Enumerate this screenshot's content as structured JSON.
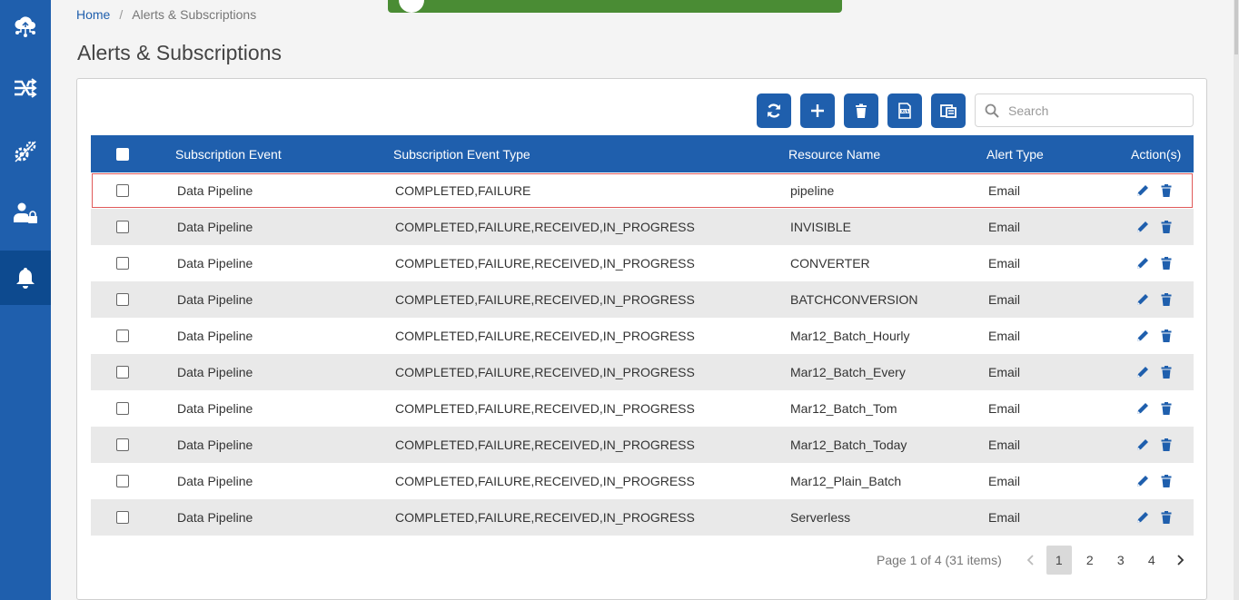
{
  "breadcrumb": {
    "home": "Home",
    "separator": "/",
    "current": "Alerts & Subscriptions"
  },
  "page": {
    "title": "Alerts & Subscriptions"
  },
  "sidebar": {
    "items": [
      {
        "icon": "cloud-network-icon",
        "active": false
      },
      {
        "icon": "pipeline-shuffle-icon",
        "active": false
      },
      {
        "icon": "settings-gears-icon",
        "active": false
      },
      {
        "icon": "user-lock-icon",
        "active": false
      },
      {
        "icon": "bell-icon",
        "active": true
      }
    ]
  },
  "toast": {
    "color": "#4a8c34"
  },
  "toolbar": {
    "buttons": [
      "refresh-icon",
      "plus-icon",
      "trash-icon",
      "xlsx-export-icon",
      "column-settings-icon"
    ],
    "search_placeholder": "Search"
  },
  "table": {
    "headers": {
      "event": "Subscription Event",
      "event_type": "Subscription Event Type",
      "resource": "Resource Name",
      "alert_type": "Alert Type",
      "actions": "Action(s)"
    },
    "rows": [
      {
        "event": "Data Pipeline",
        "event_type": "COMPLETED,FAILURE",
        "resource": "pipeline",
        "alert_type": "Email"
      },
      {
        "event": "Data Pipeline",
        "event_type": "COMPLETED,FAILURE,RECEIVED,IN_PROGRESS",
        "resource": "INVISIBLE",
        "alert_type": "Email"
      },
      {
        "event": "Data Pipeline",
        "event_type": "COMPLETED,FAILURE,RECEIVED,IN_PROGRESS",
        "resource": "CONVERTER",
        "alert_type": "Email"
      },
      {
        "event": "Data Pipeline",
        "event_type": "COMPLETED,FAILURE,RECEIVED,IN_PROGRESS",
        "resource": "BATCHCONVERSION",
        "alert_type": "Email"
      },
      {
        "event": "Data Pipeline",
        "event_type": "COMPLETED,FAILURE,RECEIVED,IN_PROGRESS",
        "resource": "Mar12_Batch_Hourly",
        "alert_type": "Email"
      },
      {
        "event": "Data Pipeline",
        "event_type": "COMPLETED,FAILURE,RECEIVED,IN_PROGRESS",
        "resource": "Mar12_Batch_Every",
        "alert_type": "Email"
      },
      {
        "event": "Data Pipeline",
        "event_type": "COMPLETED,FAILURE,RECEIVED,IN_PROGRESS",
        "resource": "Mar12_Batch_Tom",
        "alert_type": "Email"
      },
      {
        "event": "Data Pipeline",
        "event_type": "COMPLETED,FAILURE,RECEIVED,IN_PROGRESS",
        "resource": "Mar12_Batch_Today",
        "alert_type": "Email"
      },
      {
        "event": "Data Pipeline",
        "event_type": "COMPLETED,FAILURE,RECEIVED,IN_PROGRESS",
        "resource": "Mar12_Plain_Batch",
        "alert_type": "Email"
      },
      {
        "event": "Data Pipeline",
        "event_type": "COMPLETED,FAILURE,RECEIVED,IN_PROGRESS",
        "resource": "Serverless",
        "alert_type": "Email"
      }
    ]
  },
  "pagination": {
    "info": "Page 1 of 4 (31 items)",
    "pages": [
      "1",
      "2",
      "3",
      "4"
    ],
    "current": "1"
  },
  "colors": {
    "primary": "#1f5fad",
    "sidebar_active": "#0d4a8f",
    "row_alt": "#e9e9e9",
    "selected_outline": "#e05a5a"
  }
}
